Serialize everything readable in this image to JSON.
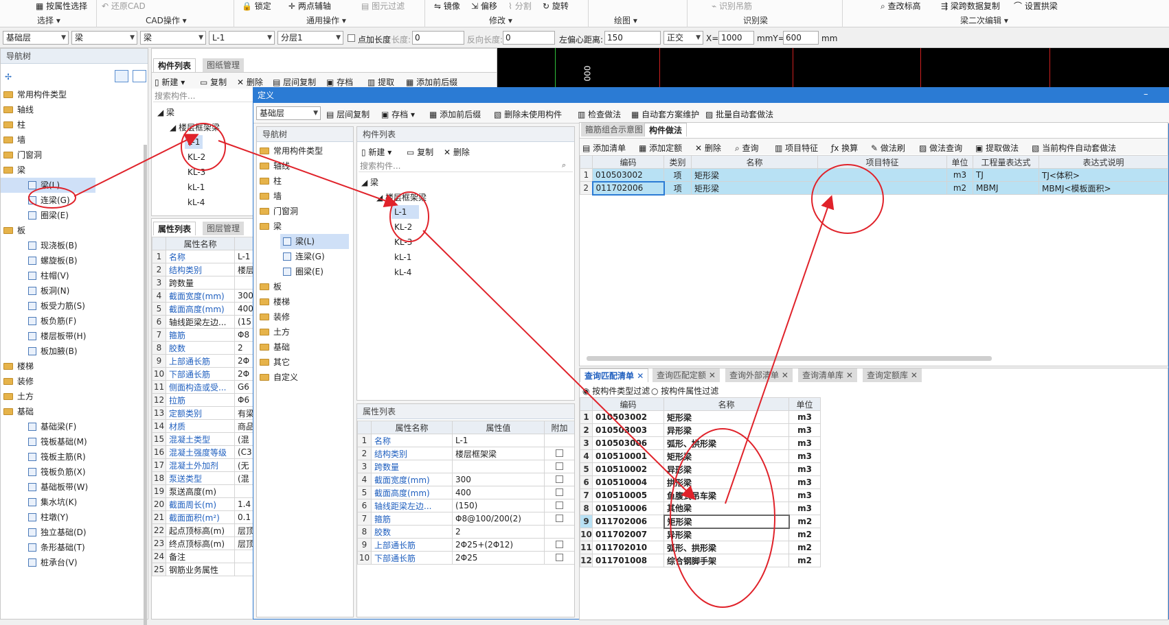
{
  "ribbon": {
    "items": [
      "按属性选择",
      "还原CAD",
      "锁定",
      "两点辅轴",
      "图元过滤",
      "镜像",
      "偏移",
      "分割",
      "旋转",
      "识别吊筋",
      "查改标高",
      "梁跨数据复制",
      "设置拱梁"
    ],
    "groups": [
      "选择",
      "CAD操作",
      "通用操作",
      "修改",
      "绘图",
      "识别梁",
      "梁二次编辑"
    ]
  },
  "toolbar": {
    "floor": "基础层",
    "type1": "梁",
    "type2": "梁",
    "element": "L-1",
    "layer": "分层1",
    "point_len_label": "点加长度",
    "len_label": "长度:",
    "len_value": "0",
    "rev_len_label": "反向长度:",
    "rev_len_value": "0",
    "left_offset_label": "左偏心距离:",
    "left_offset_value": "150",
    "ortho": "正交",
    "x_label": "X=",
    "x_value": "1000",
    "mm_y_label": "mmY=",
    "y_value": "600",
    "mm_label": "mm"
  },
  "nav": {
    "title": "导航树",
    "items": [
      {
        "label": "常用构件类型",
        "kind": "folder",
        "indent": 0
      },
      {
        "label": "轴线",
        "kind": "folder",
        "indent": 0
      },
      {
        "label": "柱",
        "kind": "folder",
        "indent": 0
      },
      {
        "label": "墙",
        "kind": "folder",
        "indent": 0
      },
      {
        "label": "门窗洞",
        "kind": "folder",
        "indent": 0
      },
      {
        "label": "梁",
        "kind": "folder",
        "indent": 0
      },
      {
        "label": "梁(L)",
        "kind": "item",
        "indent": 1,
        "selected": true
      },
      {
        "label": "连梁(G)",
        "kind": "item",
        "indent": 1
      },
      {
        "label": "圈梁(E)",
        "kind": "item",
        "indent": 1
      },
      {
        "label": "板",
        "kind": "folder",
        "indent": 0
      },
      {
        "label": "现浇板(B)",
        "kind": "item",
        "indent": 1
      },
      {
        "label": "螺旋板(B)",
        "kind": "item",
        "indent": 1
      },
      {
        "label": "柱帽(V)",
        "kind": "item",
        "indent": 1
      },
      {
        "label": "板洞(N)",
        "kind": "item",
        "indent": 1
      },
      {
        "label": "板受力筋(S)",
        "kind": "item",
        "indent": 1
      },
      {
        "label": "板负筋(F)",
        "kind": "item",
        "indent": 1
      },
      {
        "label": "楼层板带(H)",
        "kind": "item",
        "indent": 1
      },
      {
        "label": "板加腋(B)",
        "kind": "item",
        "indent": 1
      },
      {
        "label": "楼梯",
        "kind": "folder",
        "indent": 0
      },
      {
        "label": "装修",
        "kind": "folder",
        "indent": 0
      },
      {
        "label": "土方",
        "kind": "folder",
        "indent": 0
      },
      {
        "label": "基础",
        "kind": "folder",
        "indent": 0
      },
      {
        "label": "基础梁(F)",
        "kind": "item",
        "indent": 1
      },
      {
        "label": "筏板基础(M)",
        "kind": "item",
        "indent": 1
      },
      {
        "label": "筏板主筋(R)",
        "kind": "item",
        "indent": 1
      },
      {
        "label": "筏板负筋(X)",
        "kind": "item",
        "indent": 1
      },
      {
        "label": "基础板带(W)",
        "kind": "item",
        "indent": 1
      },
      {
        "label": "集水坑(K)",
        "kind": "item",
        "indent": 1
      },
      {
        "label": "柱墩(Y)",
        "kind": "item",
        "indent": 1
      },
      {
        "label": "独立基础(D)",
        "kind": "item",
        "indent": 1
      },
      {
        "label": "条形基础(T)",
        "kind": "item",
        "indent": 1
      },
      {
        "label": "桩承台(V)",
        "kind": "item",
        "indent": 1
      }
    ]
  },
  "comp_panel": {
    "tab1": "构件列表",
    "tab2": "图纸管理",
    "btn_new": "新建",
    "btn_copy": "复制",
    "btn_delete": "删除",
    "btn_floor_copy": "层间复制",
    "btn_save": "存档",
    "btn_extract": "提取",
    "btn_add_front": "添加前后缀",
    "search_placeholder": "搜索构件...",
    "tree_root": "梁",
    "tree_group": "楼层框架梁",
    "tree_items": [
      "L-1",
      "KL-2",
      "KL-3",
      "kL-1",
      "kL-4"
    ]
  },
  "prop_panel": {
    "tab1": "属性列表",
    "tab2": "图层管理",
    "header": "属性名称",
    "rows": [
      {
        "n": "1",
        "name": "名称",
        "val": "L-1",
        "blue": true
      },
      {
        "n": "2",
        "name": "结构类别",
        "val": "楼层",
        "blue": true
      },
      {
        "n": "3",
        "name": "跨数量",
        "val": "",
        "blue": false
      },
      {
        "n": "4",
        "name": "截面宽度(mm)",
        "val": "300",
        "blue": true
      },
      {
        "n": "5",
        "name": "截面高度(mm)",
        "val": "400",
        "blue": true
      },
      {
        "n": "6",
        "name": "轴线距梁左边...",
        "val": "(15",
        "blue": false
      },
      {
        "n": "7",
        "name": "箍筋",
        "val": "Φ8",
        "blue": true
      },
      {
        "n": "8",
        "name": "胶数",
        "val": "2",
        "blue": true
      },
      {
        "n": "9",
        "name": "上部通长筋",
        "val": "2Φ",
        "blue": true
      },
      {
        "n": "10",
        "name": "下部通长筋",
        "val": "2Φ",
        "blue": true
      },
      {
        "n": "11",
        "name": "侧面构造或受...",
        "val": "G6",
        "blue": true
      },
      {
        "n": "12",
        "name": "拉筋",
        "val": "Φ6",
        "blue": true
      },
      {
        "n": "13",
        "name": "定额类别",
        "val": "有梁",
        "blue": true
      },
      {
        "n": "14",
        "name": "材质",
        "val": "商品",
        "blue": true
      },
      {
        "n": "15",
        "name": "混凝土类型",
        "val": "(混",
        "blue": true
      },
      {
        "n": "16",
        "name": "混凝土强度等级",
        "val": "(C3",
        "blue": true
      },
      {
        "n": "17",
        "name": "混凝土外加剂",
        "val": "(无",
        "blue": true
      },
      {
        "n": "18",
        "name": "泵送类型",
        "val": "(混",
        "blue": true
      },
      {
        "n": "19",
        "name": "泵送高度(m)",
        "val": "",
        "blue": false
      },
      {
        "n": "20",
        "name": "截面周长(m)",
        "val": "1.4",
        "blue": true
      },
      {
        "n": "21",
        "name": "截面面积(m²)",
        "val": "0.1",
        "blue": true
      },
      {
        "n": "22",
        "name": "起点顶标高(m)",
        "val": "层顶",
        "blue": false
      },
      {
        "n": "23",
        "name": "终点顶标高(m)",
        "val": "层顶",
        "blue": false
      },
      {
        "n": "24",
        "name": "备注",
        "val": "",
        "blue": false
      },
      {
        "n": "25",
        "name": "钢筋业务属性",
        "val": "",
        "blue": false
      }
    ]
  },
  "define": {
    "title": "定义",
    "floor": "基础层",
    "btn_floor_copy": "层间复制",
    "btn_save": "存档",
    "btn_add_front": "添加前后缀",
    "btn_del_unused": "删除未使用构件",
    "btn_check": "检查做法",
    "btn_auto_maint": "自动套方案维护",
    "btn_batch_auto": "批量自动套做法",
    "nav_title": "导航树",
    "nav_items": [
      {
        "label": "常用构件类型",
        "kind": "folder",
        "indent": 0
      },
      {
        "label": "轴线",
        "kind": "folder",
        "indent": 0
      },
      {
        "label": "柱",
        "kind": "folder",
        "indent": 0
      },
      {
        "label": "墙",
        "kind": "folder",
        "indent": 0
      },
      {
        "label": "门窗洞",
        "kind": "folder",
        "indent": 0
      },
      {
        "label": "梁",
        "kind": "folder",
        "indent": 0
      },
      {
        "label": "梁(L)",
        "kind": "item",
        "indent": 1,
        "selected": true
      },
      {
        "label": "连梁(G)",
        "kind": "item",
        "indent": 1
      },
      {
        "label": "圈梁(E)",
        "kind": "item",
        "indent": 1
      },
      {
        "label": "板",
        "kind": "folder",
        "indent": 0
      },
      {
        "label": "楼梯",
        "kind": "folder",
        "indent": 0
      },
      {
        "label": "装修",
        "kind": "folder",
        "indent": 0
      },
      {
        "label": "土方",
        "kind": "folder",
        "indent": 0
      },
      {
        "label": "基础",
        "kind": "folder",
        "indent": 0
      },
      {
        "label": "其它",
        "kind": "folder",
        "indent": 0
      },
      {
        "label": "自定义",
        "kind": "folder",
        "indent": 0
      }
    ],
    "comp_title": "构件列表",
    "btn_new": "新建",
    "btn_copy": "复制",
    "btn_delete": "删除",
    "search_placeholder": "搜索构件...",
    "tree_root": "梁",
    "tree_group": "楼层框架梁",
    "tree_items": [
      "L-1",
      "KL-2",
      "KL-3",
      "kL-1",
      "kL-4"
    ],
    "prop_title": "属性列表",
    "prop_headers": [
      "属性名称",
      "属性值",
      "附加"
    ],
    "prop_rows": [
      {
        "n": "1",
        "name": "名称",
        "val": "L-1",
        "chk": false
      },
      {
        "n": "2",
        "name": "结构类别",
        "val": "楼层框架梁",
        "chk": true
      },
      {
        "n": "3",
        "name": "跨数量",
        "val": "",
        "chk": true
      },
      {
        "n": "4",
        "name": "截面宽度(mm)",
        "val": "300",
        "chk": true
      },
      {
        "n": "5",
        "name": "截面高度(mm)",
        "val": "400",
        "chk": true
      },
      {
        "n": "6",
        "name": "轴线距梁左边...",
        "val": "(150)",
        "chk": true
      },
      {
        "n": "7",
        "name": "箍筋",
        "val": "Φ8@100/200(2)",
        "chk": true
      },
      {
        "n": "8",
        "name": "胶数",
        "val": "2",
        "chk": false
      },
      {
        "n": "9",
        "name": "上部通长筋",
        "val": "2Φ25+(2Φ12)",
        "chk": true
      },
      {
        "n": "10",
        "name": "下部通长筋",
        "val": "2Φ25",
        "chk": true
      }
    ],
    "right_tab1": "箍筋组合示意图",
    "right_tab2": "构件做法",
    "method_buttons": [
      "添加清单",
      "添加定额",
      "删除",
      "查询",
      "项目特征",
      "换算",
      "做法刷",
      "做法查询",
      "提取做法",
      "当前构件自动套做法"
    ],
    "method_headers": [
      "编码",
      "类别",
      "名称",
      "项目特征",
      "单位",
      "工程量表达式",
      "表达式说明"
    ],
    "method_rows": [
      {
        "n": "1",
        "code": "010503002",
        "cat": "项",
        "name": "矩形梁",
        "feat": "",
        "unit": "m3",
        "expr": "TJ",
        "desc": "TJ<体积>"
      },
      {
        "n": "2",
        "code": "011702006",
        "cat": "项",
        "name": "矩形梁",
        "feat": "",
        "unit": "m2",
        "expr": "MBMJ",
        "desc": "MBMJ<模板面积>"
      }
    ],
    "query_tabs": [
      "查询匹配清单",
      "查询匹配定额",
      "查询外部清单",
      "查询清单库",
      "查询定额库"
    ],
    "radio1": "按构件类型过滤",
    "radio2": "按构件属性过滤",
    "query_headers": [
      "编码",
      "名称",
      "单位"
    ],
    "query_rows": [
      {
        "n": "1",
        "code": "010503002",
        "name": "矩形梁",
        "unit": "m3"
      },
      {
        "n": "2",
        "code": "010503003",
        "name": "异形梁",
        "unit": "m3"
      },
      {
        "n": "3",
        "code": "010503006",
        "name": "弧形、拱形梁",
        "unit": "m3"
      },
      {
        "n": "4",
        "code": "010510001",
        "name": "矩形梁",
        "unit": "m3"
      },
      {
        "n": "5",
        "code": "010510002",
        "name": "异形梁",
        "unit": "m3"
      },
      {
        "n": "6",
        "code": "010510004",
        "name": "拱形梁",
        "unit": "m3"
      },
      {
        "n": "7",
        "code": "010510005",
        "name": "鱼腹式吊车梁",
        "unit": "m3"
      },
      {
        "n": "8",
        "code": "010510006",
        "name": "其他梁",
        "unit": "m3"
      },
      {
        "n": "9",
        "code": "011702006",
        "name": "矩形梁",
        "unit": "m2"
      },
      {
        "n": "10",
        "code": "011702007",
        "name": "异形梁",
        "unit": "m2"
      },
      {
        "n": "11",
        "code": "011702010",
        "name": "弧形、拱形梁",
        "unit": "m2"
      },
      {
        "n": "12",
        "code": "011701008",
        "name": "综合钢脚手架",
        "unit": "m2"
      }
    ]
  },
  "cad": {
    "label": "000"
  },
  "colors": {
    "accent": "#2b7bd4",
    "annotation": "#e0222a",
    "highlight": "#b8e1f4"
  }
}
